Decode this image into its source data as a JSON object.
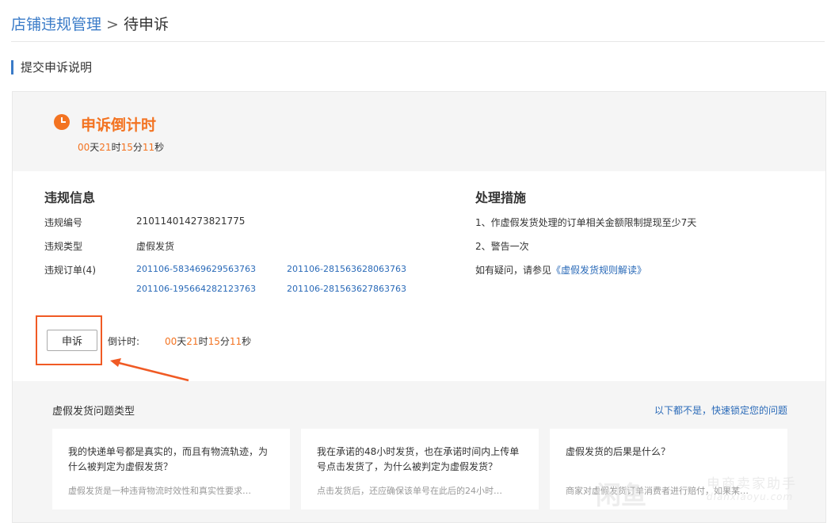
{
  "breadcrumb": {
    "root": "店铺违规管理",
    "separator": ">",
    "current": "待申诉"
  },
  "section_title": "提交申诉说明",
  "countdown": {
    "title": "申诉倒计时",
    "days": "00",
    "days_unit": "天",
    "hours": "21",
    "hours_unit": "时",
    "minutes": "15",
    "minutes_unit": "分",
    "seconds": "11",
    "seconds_unit": "秒",
    "icon": "clock-icon"
  },
  "violation": {
    "heading": "违规信息",
    "id_label": "违规编号",
    "id_value": "210114014273821775",
    "type_label": "违规类型",
    "type_value": "虚假发货",
    "orders_label": "违规订单(4)",
    "orders": [
      "201106-583469629563763",
      "201106-281563628063763",
      "201106-195664282123763",
      "201106-281563627863763"
    ]
  },
  "measures": {
    "heading": "处理措施",
    "items": [
      "1、作虚假发货处理的订单相关金额限制提现至少7天",
      "2、警告一次"
    ],
    "help_prefix": "如有疑问，请参见",
    "help_link": "《虚假发货规则解读》"
  },
  "appeal": {
    "button_label": "申诉",
    "countdown_label": "倒计时:"
  },
  "faq": {
    "title": "虚假发货问题类型",
    "more_link": "以下都不是，快速锁定您的问题",
    "cards": [
      {
        "q": "我的快递单号都是真实的，而且有物流轨迹，为什么被判定为虚假发货？",
        "a": "虚假发货是一种违背物流时效性和真实性要求…"
      },
      {
        "q": "我在承诺的48小时发货，也在承诺时间内上传单号点击发货了，为什么被判定为虚假发货？",
        "a": "点击发货后，还应确保该单号在此后的24小时…"
      },
      {
        "q": "虚假发货的后果是什么？",
        "a": "商家对虚假发货订单消费者进行赔付，如果某…"
      }
    ]
  },
  "watermark": {
    "cn": "电商卖家助手",
    "en": "dianxiaoyu.com",
    "logo": "闲鱼"
  },
  "colors": {
    "accent": "#f37321",
    "link": "#2a6ab8",
    "highlight": "#f05a24"
  }
}
